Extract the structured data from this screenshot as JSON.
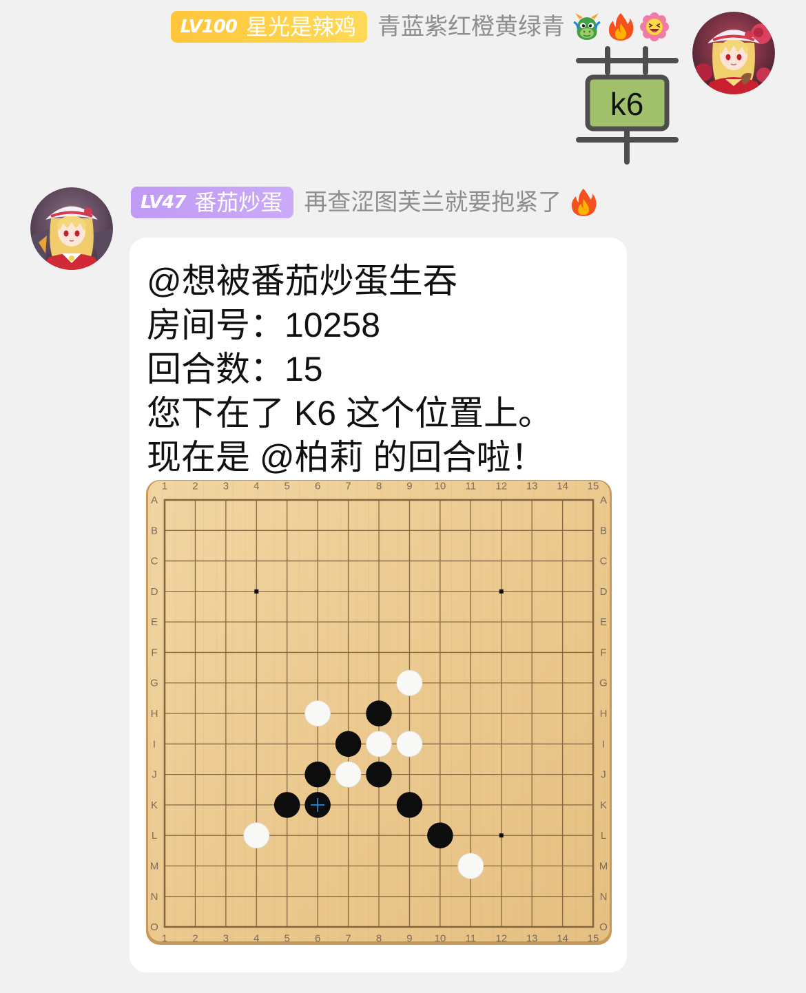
{
  "chat": {
    "message_1": {
      "level": "LV100",
      "nickname": "星光是辣鸡",
      "title": "青蓝紫红橙黄绿青",
      "title_icons": [
        "dragon-icon",
        "fire-icon",
        "laughing-flower-icon"
      ],
      "badge_colors": [
        "#ffc53a",
        "#ffda58"
      ],
      "sticker": {
        "glyph": "草",
        "label": "k6",
        "box_color": "#a0c06c",
        "stroke_color": "#4e4e4e"
      }
    },
    "message_2": {
      "level": "LV47",
      "nickname": "番茄炒蛋",
      "title": "再查涩图芙兰就要抱紧了",
      "title_icons": [
        "fire-icon"
      ],
      "badge_colors": [
        "#c09af4",
        "#cbaaf8"
      ],
      "mention": "@想被番茄炒蛋生吞",
      "room_label": "房间号：",
      "room_number": "10258",
      "turn_label": "回合数：",
      "turn_count": "15",
      "move_text": "您下在了 K6 这个位置上。",
      "next_turn_text": "现在是 @柏莉 的回合啦！",
      "board": {
        "size": 15,
        "column_labels": [
          "1",
          "2",
          "3",
          "4",
          "5",
          "6",
          "7",
          "8",
          "9",
          "10",
          "11",
          "12",
          "13",
          "14",
          "15"
        ],
        "row_labels": [
          "A",
          "B",
          "C",
          "D",
          "E",
          "F",
          "G",
          "H",
          "I",
          "J",
          "K",
          "L",
          "M",
          "N",
          "O"
        ],
        "star_points": [
          {
            "row": 4,
            "col": 4
          },
          {
            "row": 4,
            "col": 12
          },
          {
            "row": 12,
            "col": 12
          }
        ],
        "last_move": {
          "row": 11,
          "col": 6
        },
        "stones": [
          {
            "row": 7,
            "col": 9,
            "color": "white"
          },
          {
            "row": 8,
            "col": 6,
            "color": "white"
          },
          {
            "row": 8,
            "col": 8,
            "color": "black"
          },
          {
            "row": 9,
            "col": 7,
            "color": "black"
          },
          {
            "row": 9,
            "col": 8,
            "color": "white"
          },
          {
            "row": 9,
            "col": 9,
            "color": "white"
          },
          {
            "row": 10,
            "col": 6,
            "color": "black"
          },
          {
            "row": 10,
            "col": 7,
            "color": "white"
          },
          {
            "row": 10,
            "col": 8,
            "color": "black"
          },
          {
            "row": 11,
            "col": 5,
            "color": "black"
          },
          {
            "row": 11,
            "col": 6,
            "color": "black"
          },
          {
            "row": 11,
            "col": 9,
            "color": "black"
          },
          {
            "row": 12,
            "col": 4,
            "color": "white"
          },
          {
            "row": 12,
            "col": 10,
            "color": "black"
          },
          {
            "row": 13,
            "col": 11,
            "color": "white"
          }
        ]
      }
    }
  },
  "colors": {
    "background": "#f1f1f1",
    "bubble": "#ffffff",
    "title_text": "#8e8e8e",
    "message_text": "#111111",
    "grid_line": "#86663f",
    "label_text": "#7b6c5a",
    "black_stone": "#0d0d0d",
    "white_stone": "#f8f8f6",
    "last_move_marker": "#2b88d8"
  }
}
